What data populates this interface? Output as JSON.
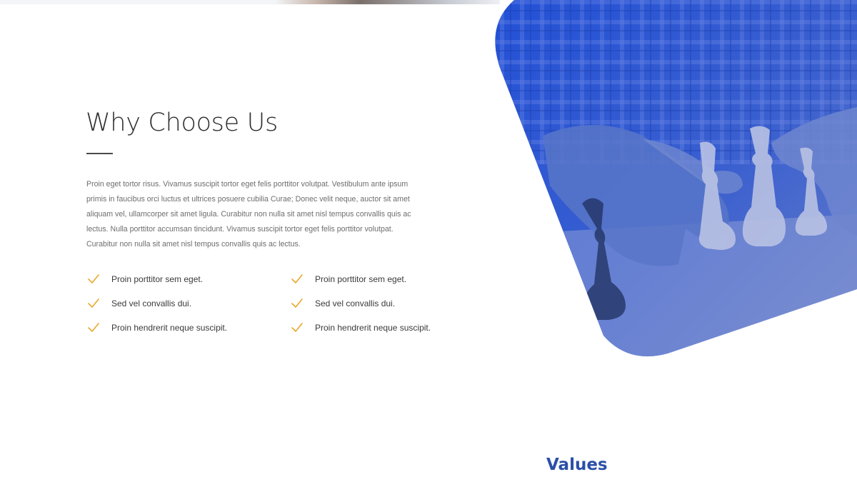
{
  "section": {
    "title": "Why Choose Us",
    "paragraph": "Proin eget tortor risus. Vivamus suscipit tortor eget felis porttitor volutpat. Vestibulum ante ipsum primis in faucibus orci luctus et ultrices posuere cubilia Curae; Donec velit neque, auctor sit amet aliquam vel, ullamcorper sit amet ligula. Curabitur non nulla sit amet nisl tempus convallis quis ac lectus. Nulla porttitor accumsan tincidunt. Vivamus suscipit tortor eget felis porttitor volutpat. Curabitur non nulla sit amet nisl tempus convallis quis ac lectus.",
    "features_left": [
      "Proin porttitor sem eget.",
      "Sed vel convallis dui.",
      "Proin hendrerit neque suscipit."
    ],
    "features_right": [
      "Proin porttitor sem eget.",
      "Sed vel convallis dui.",
      "Proin hendrerit neque suscipit."
    ]
  },
  "values": {
    "heading": "Values"
  },
  "colors": {
    "accent_blue": "#2b4fa8",
    "check_gold": "#e8a92b",
    "image_overlay": "#2d58d6"
  },
  "icons": {
    "feature_check": "check-icon",
    "hero_image": "chess-pieces-image"
  }
}
